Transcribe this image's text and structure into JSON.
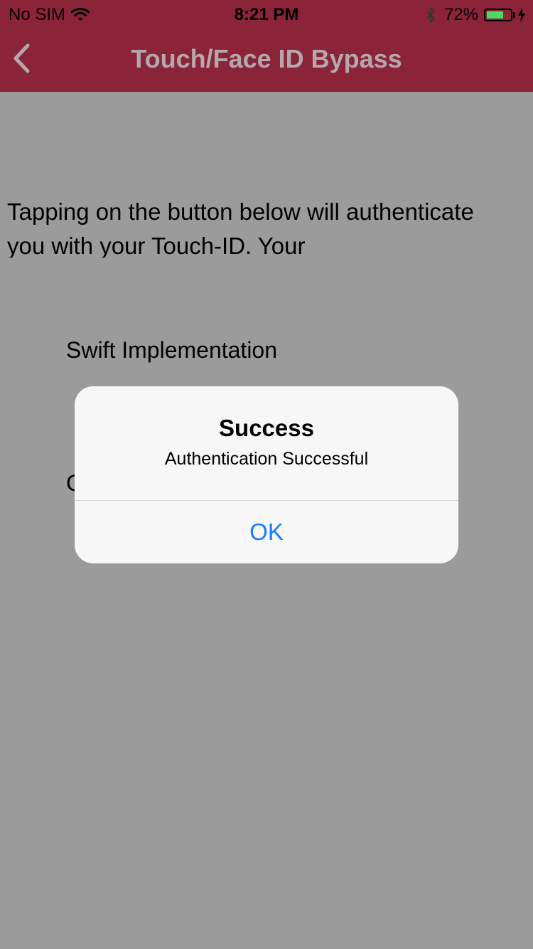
{
  "status_bar": {
    "carrier": "No SIM",
    "time": "8:21 PM",
    "battery": "72%",
    "battery_level": 0.72,
    "wifi_icon": "wifi-icon",
    "bluetooth_icon": "bluetooth-icon",
    "charging_icon": "charging-bolt-icon"
  },
  "nav": {
    "title": "Touch/Face ID Bypass",
    "back_icon": "chevron-left-icon"
  },
  "main": {
    "description": "Tapping on the button below will authenticate you with your Touch-ID. Your",
    "swift_label": "Swift Implementation",
    "objc_label": "C"
  },
  "alert": {
    "title": "Success",
    "message": "Authentication Successful",
    "ok_label": "OK"
  },
  "colors": {
    "nav_background": "#8b2339",
    "nav_title": "#b3a9ab",
    "overlay_background": "#9b9b9b",
    "alert_background": "#f7f7f7",
    "action_blue": "#157efb",
    "battery_green": "#4cd964"
  }
}
